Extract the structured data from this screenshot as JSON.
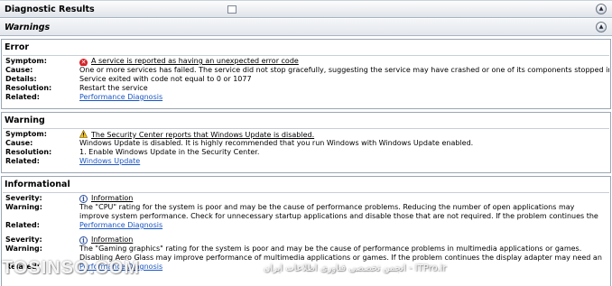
{
  "header": {
    "title": "Diagnostic Results",
    "collapse_glyph": "▲"
  },
  "subheader": {
    "title": "Warnings",
    "collapse_glyph": "▲"
  },
  "error": {
    "title": "Error",
    "labels": {
      "symptom": "Symptom:",
      "cause": "Cause:",
      "details": "Details:",
      "resolution": "Resolution:",
      "related": "Related:"
    },
    "icon_glyph": "✕",
    "symptom": "A service is reported as having an unexpected error code",
    "cause": "One or more services has failed. The service did not stop gracefully, suggesting the service may have crashed or one of its components stopped in an unsupported way.",
    "details": "Service exited with code not equal to 0 or 1077",
    "resolution": "Restart the service",
    "related": "Performance Diagnosis"
  },
  "warning": {
    "title": "Warning",
    "labels": {
      "symptom": "Symptom:",
      "cause": "Cause:",
      "resolution": "Resolution:",
      "related": "Related:"
    },
    "symptom": "The Security Center reports that Windows Update is disabled.",
    "cause": "Windows Update is disabled. It is highly recommended that you run Windows with Windows Update enabled.",
    "resolution": "1. Enable Windows Update in the Security Center.",
    "related": "Windows Update"
  },
  "informational": {
    "title": "Informational",
    "labels": {
      "severity": "Severity:",
      "warning": "Warning:",
      "related": "Related:"
    },
    "icon_glyph": "i",
    "items": [
      {
        "severity": "Information",
        "warning": "The \"CPU\" rating for the system is poor and may be the cause of performance problems. Reducing the number of open applications may improve system performance. Check for unnecessary startup applications and disable those that are not required. If the problem continues the CPU may need to be upgraded.",
        "related": "Performance Diagnosis"
      },
      {
        "severity": "Information",
        "warning": "The \"Gaming graphics\" rating for the system is poor and may be the cause of performance problems in multimedia applications or games. Disabling Aero Glass may improve performance of multimedia applications or games. If the problem continues the display adapter may need an updated driver or may need to be upgraded.",
        "related": "Performance Diagnosis"
      }
    ]
  },
  "watermark": {
    "left": "TOSINSO.COM",
    "right": "انجمن تخصصی فناوری اطلاعات ایران - ITPro.ir"
  },
  "colors": {
    "link": "#1a56c4",
    "error_icon": "#d2232a",
    "warning_icon": "#f2c21b",
    "info_icon": "#2b4f9e",
    "border": "#9aa6b4"
  }
}
